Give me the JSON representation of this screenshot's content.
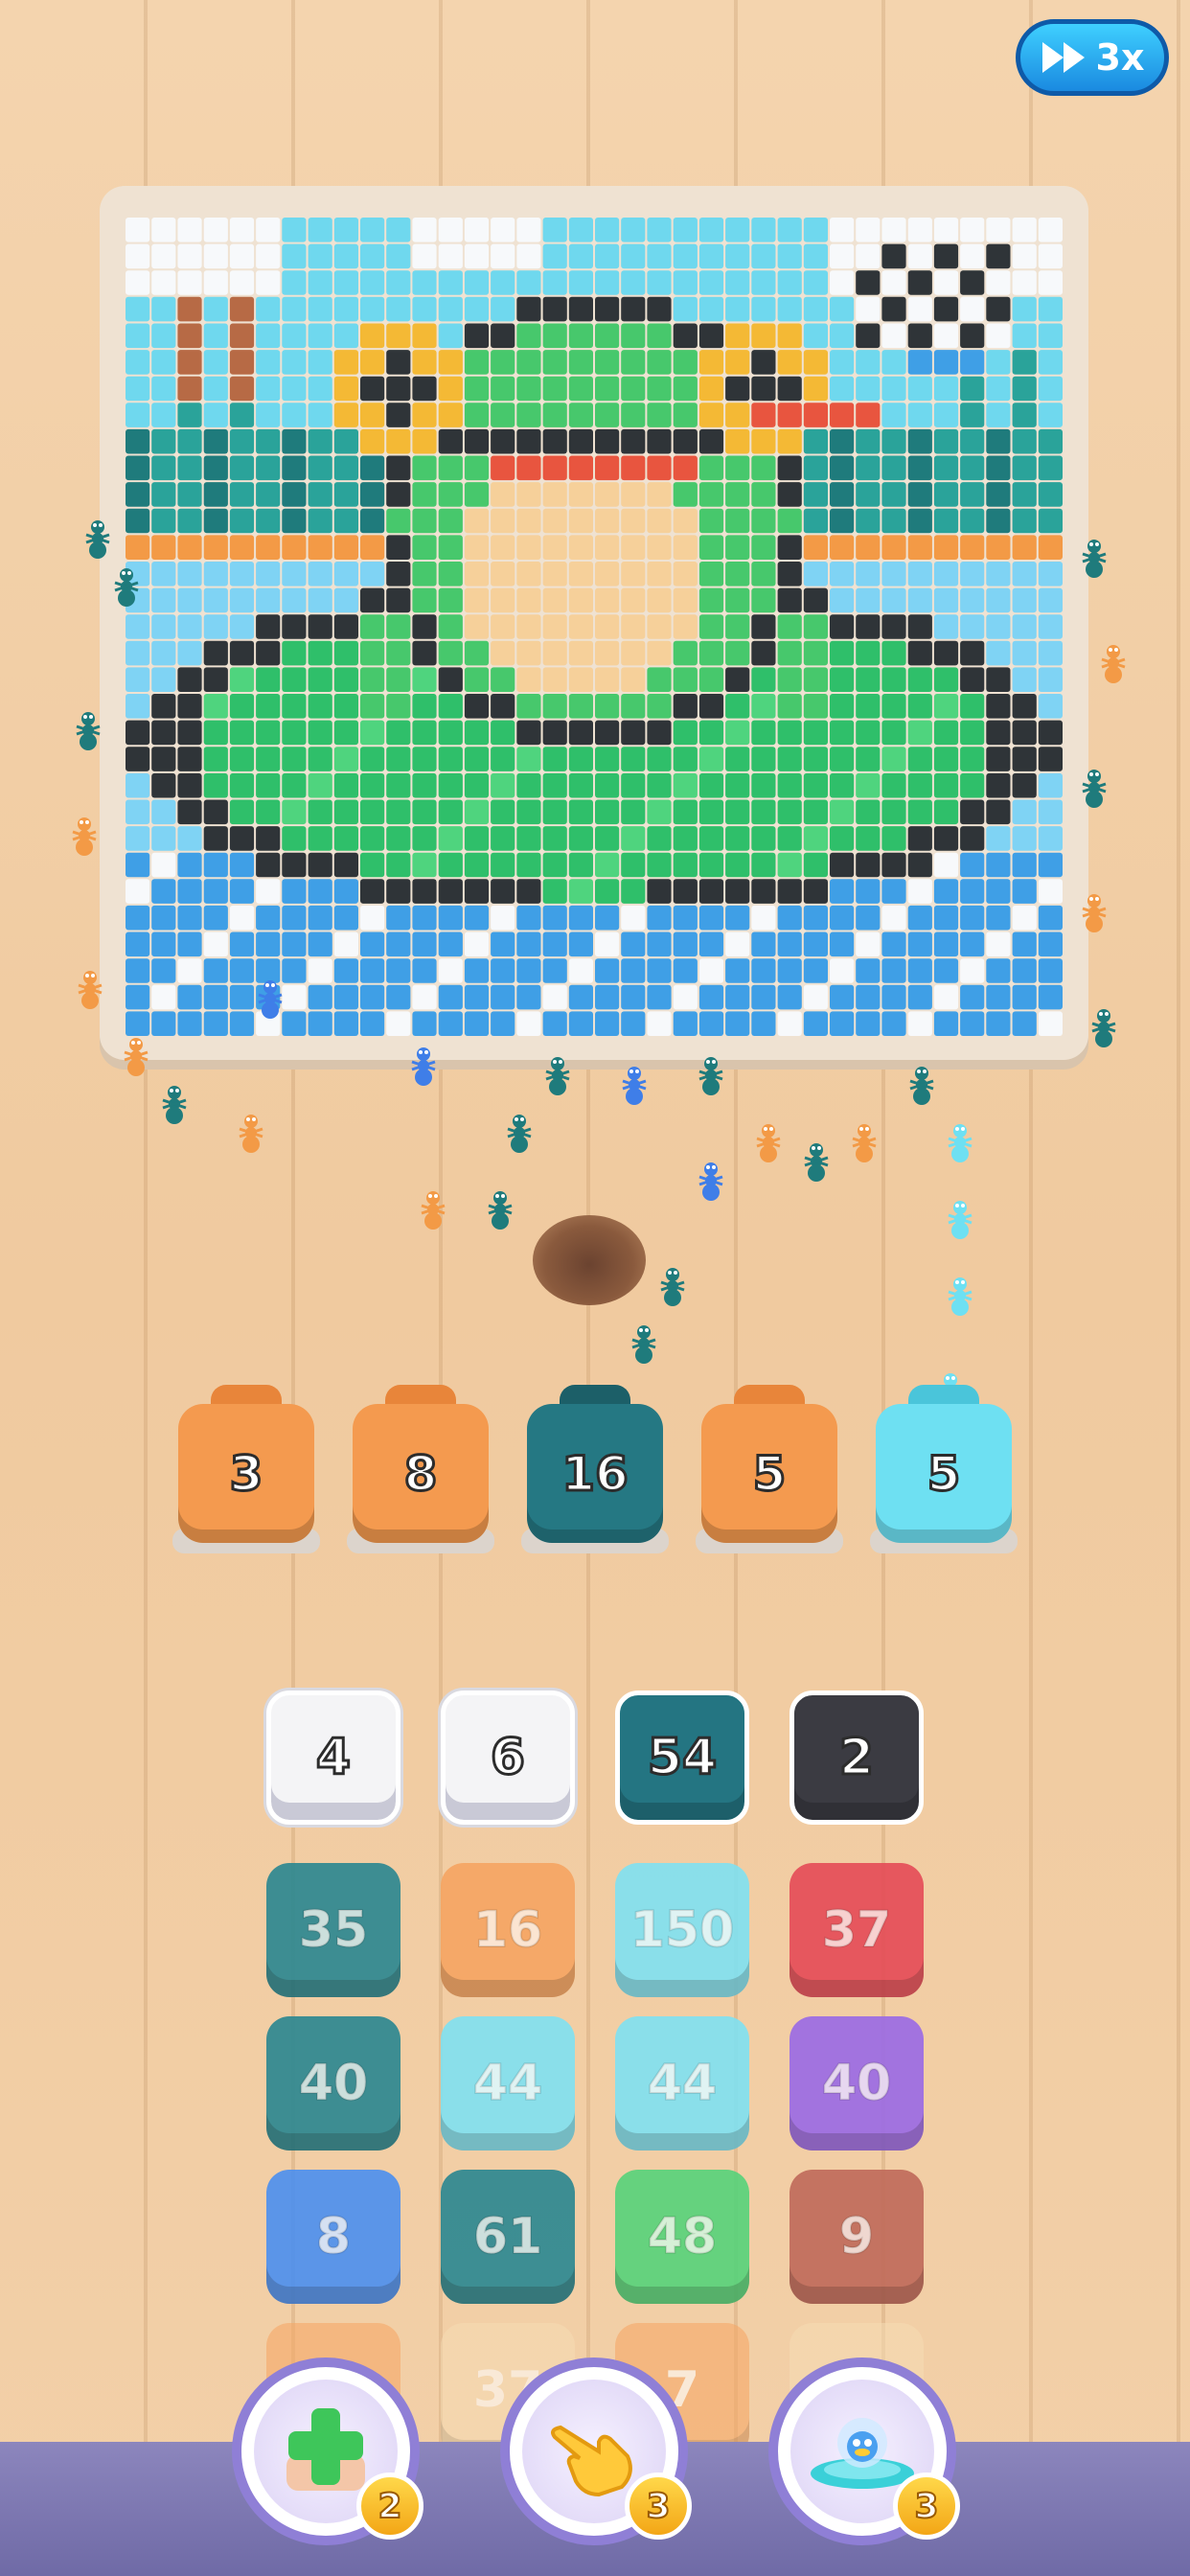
{
  "speed_button": {
    "label": "3x",
    "icon": "fast-forward-icon"
  },
  "bins": [
    {
      "count": "3",
      "color": "#f49a4f",
      "handle": "#e8853a"
    },
    {
      "count": "8",
      "color": "#f49a4f",
      "handle": "#e8853a"
    },
    {
      "count": "16",
      "color": "#257883",
      "handle": "#1c5f68"
    },
    {
      "count": "5",
      "color": "#f49a4f",
      "handle": "#e8853a"
    },
    {
      "count": "5",
      "color": "#6ee0f2",
      "handle": "#4ac5da"
    }
  ],
  "tiles": [
    [
      {
        "value": "4",
        "color": "#f4f4f6",
        "state": "active"
      },
      {
        "value": "6",
        "color": "#f4f4f6",
        "state": "active"
      },
      {
        "value": "54",
        "color": "#247582",
        "state": "active"
      },
      {
        "value": "2",
        "color": "#3b3b42",
        "state": "active"
      }
    ],
    [
      {
        "value": "35",
        "color": "#2a8791",
        "state": "locked"
      },
      {
        "value": "16",
        "color": "#f6a562",
        "state": "locked"
      },
      {
        "value": "150",
        "color": "#7fe1f2",
        "state": "locked"
      },
      {
        "value": "37",
        "color": "#e54b57",
        "state": "locked"
      }
    ],
    [
      {
        "value": "40",
        "color": "#2a8791",
        "state": "locked"
      },
      {
        "value": "44",
        "color": "#7fe1f2",
        "state": "locked"
      },
      {
        "value": "44",
        "color": "#7fe1f2",
        "state": "locked"
      },
      {
        "value": "40",
        "color": "#9a6ae6",
        "state": "locked"
      }
    ],
    [
      {
        "value": "8",
        "color": "#4b8ff0",
        "state": "locked"
      },
      {
        "value": "61",
        "color": "#2a8791",
        "state": "locked"
      },
      {
        "value": "48",
        "color": "#56d37a",
        "state": "locked"
      },
      {
        "value": "9",
        "color": "#c06a5a",
        "state": "locked"
      }
    ],
    [
      {
        "value": "",
        "color": "#f6a562",
        "state": "faded"
      },
      {
        "value": "37",
        "color": "#f6dcb4",
        "state": "faded"
      },
      {
        "value": "7",
        "color": "#f6a562",
        "state": "faded"
      },
      {
        "value": "",
        "color": "#f6dcb4",
        "state": "faded"
      }
    ]
  ],
  "boosters": [
    {
      "name": "add-slot",
      "icon": "green-plus-icon",
      "count": "2"
    },
    {
      "name": "hand",
      "icon": "pointing-hand-icon",
      "count": "3"
    },
    {
      "name": "ufo",
      "icon": "ufo-icon",
      "count": "3"
    }
  ]
}
